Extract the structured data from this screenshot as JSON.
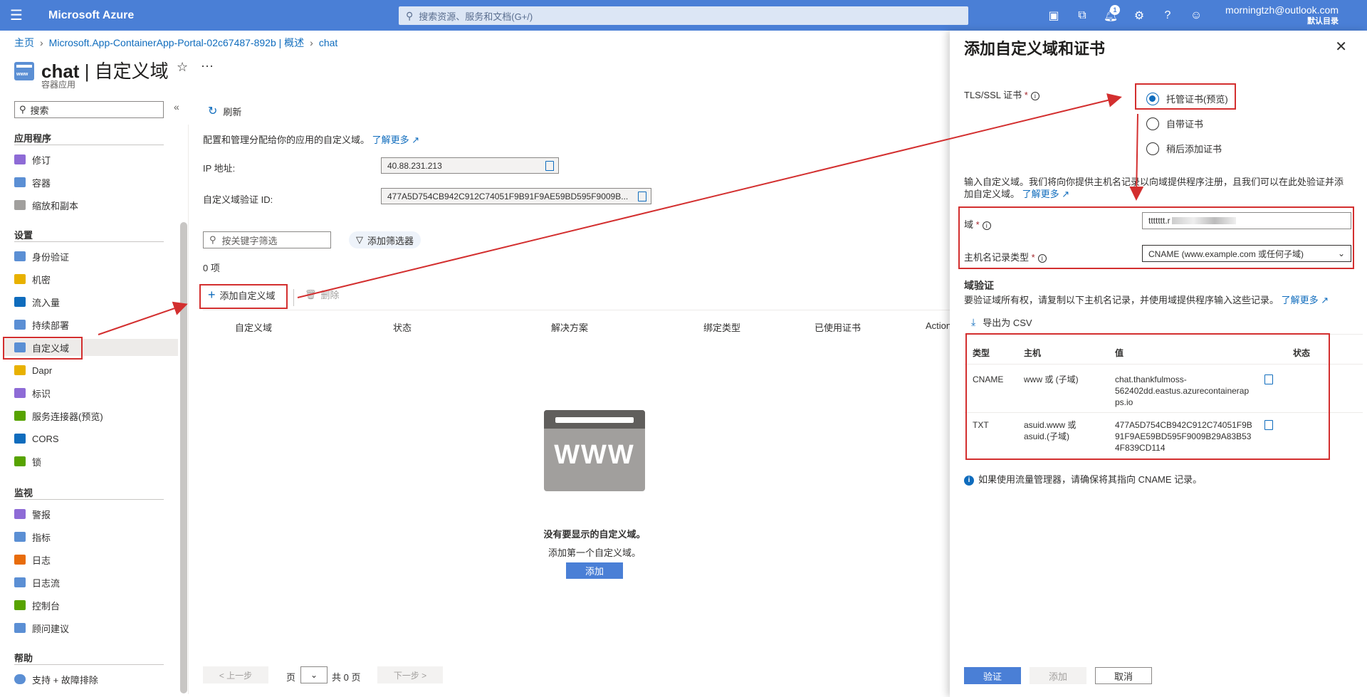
{
  "topbar": {
    "brand": "Microsoft Azure",
    "search_placeholder": "搜索资源、服务和文档(G+/)",
    "notification_count": "1",
    "account_email": "morningtzh@outlook.com",
    "account_directory": "默认目录"
  },
  "breadcrumb": [
    "主页",
    "Microsoft.App-ContainerApp-Portal-02c67487-892b | 概述",
    "chat"
  ],
  "title": {
    "resource": "chat",
    "page": "自定义域",
    "subtitle": "容器应用"
  },
  "sidebar": {
    "search_placeholder": "搜索",
    "sections": [
      {
        "label": "应用程序",
        "items": [
          "修订",
          "容器",
          "缩放和副本"
        ]
      },
      {
        "label": "设置",
        "items": [
          "身份验证",
          "机密",
          "流入量",
          "持续部署",
          "自定义域",
          "Dapr",
          "标识",
          "服务连接器(预览)",
          "CORS",
          "锁"
        ]
      },
      {
        "label": "监视",
        "items": [
          "警报",
          "指标",
          "日志",
          "日志流",
          "控制台",
          "顾问建议"
        ]
      },
      {
        "label": "帮助",
        "items": [
          "支持 + 故障排除"
        ]
      }
    ],
    "active_item": "自定义域",
    "icon_colors": [
      "#8e6bd6",
      "#5b8fd4",
      "#a19f9d",
      "#5b8fd4",
      "#e8b100",
      "#0f6cbd",
      "#5b8fd4",
      "#5b8fd4",
      "#e8b100",
      "#8e6bd6",
      "#57a300",
      "#0f6cbd",
      "#57a300",
      "#8e6bd6",
      "#5b8fd4",
      "#e86c0b",
      "#5b8fd4",
      "#57a300",
      "#5b8fd4"
    ]
  },
  "main": {
    "refresh_label": "刷新",
    "description": "配置和管理分配给你的应用的自定义域。",
    "learn_more": "了解更多",
    "ip_label": "IP 地址:",
    "ip_value": "40.88.231.213",
    "verify_label": "自定义域验证 ID:",
    "verify_value": "477A5D754CB942C912C74051F9B91F9AE59BD595F9009B...",
    "filter_placeholder": "按关键字筛选",
    "add_filter_label": "添加筛选器",
    "count_label": "0 项",
    "add_domain_label": "添加自定义域",
    "delete_label": "删除",
    "columns": [
      "自定义域",
      "状态",
      "解决方案",
      "绑定类型",
      "已使用证书",
      "Action"
    ],
    "empty_icon_text": "WWW",
    "empty_title": "没有要显示的自定义域。",
    "empty_sub": "添加第一个自定义域。",
    "empty_add": "添加",
    "pager": {
      "prev": "< 上一步",
      "page": "页",
      "total": "共 0 页",
      "next": "下一步 >"
    }
  },
  "panel": {
    "title": "添加自定义域和证书",
    "tls_label": "TLS/SSL 证书",
    "radios": [
      {
        "label": "托管证书(预览)",
        "checked": true
      },
      {
        "label": "自带证书",
        "checked": false
      },
      {
        "label": "稍后添加证书",
        "checked": false
      }
    ],
    "intro": "输入自定义域。我们将向你提供主机名记录以向域提供程序注册，且我们可以在此处验证并添加自定义域。",
    "intro_link": "了解更多",
    "domain_label": "域",
    "domain_value": "ttttttt.r",
    "record_type_label": "主机名记录类型",
    "record_type_value": "CNAME (www.example.com 或任何子域)",
    "verify_title": "域验证",
    "verify_text": "要验证域所有权，请复制以下主机名记录，并使用域提供程序输入这些记录。",
    "verify_link": "了解更多",
    "export_label": "导出为 CSV",
    "record_columns": [
      "类型",
      "主机",
      "值",
      "状态"
    ],
    "records": [
      {
        "type": "CNAME",
        "host": "www 或 (子域)",
        "value": "chat.thankfulmoss-562402dd.eastus.azurecontainerapps.io",
        "value_lines": [
          "chat.thankfulmoss-",
          "562402dd.eastus.azurecontainerap",
          "ps.io"
        ]
      },
      {
        "type": "TXT",
        "host": "asuid.www 或 asuid.(子域)",
        "host_lines": [
          "asuid.www 或",
          "asuid.(子域)"
        ],
        "value": "477A5D754CB942C912C74051F9B91F9AE59BD595F9009B29A83B534F839CD114",
        "value_lines": [
          "477A5D754CB942C912C74051F9B",
          "91F9AE59BD595F9009B29A83B53",
          "4F839CD114"
        ]
      }
    ],
    "traffic_note": "如果使用流量管理器，请确保将其指向 CNAME 记录。",
    "buttons": {
      "validate": "验证",
      "add": "添加",
      "cancel": "取消"
    }
  },
  "colors": {
    "azure_blue": "#4a7fd6",
    "link": "#0f6cbd",
    "annotation_red": "#d32f2f"
  }
}
